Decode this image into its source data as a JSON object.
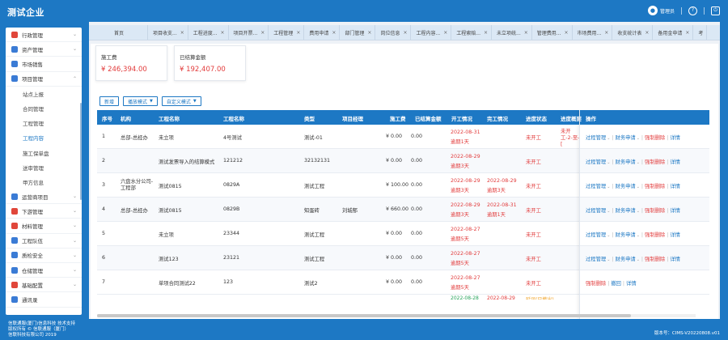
{
  "app": {
    "brand": "测试企业",
    "user": "管理员",
    "colors": {
      "primary": "#1d78c4",
      "danger": "#e23b3b",
      "warning": "#f0a020",
      "success": "#27a35a"
    }
  },
  "sidebar": {
    "items": [
      {
        "label": "行政管理",
        "icon": "admin-icon",
        "color": "#e0463a",
        "expandable": true
      },
      {
        "label": "资产管理",
        "icon": "asset-icon",
        "color": "#3a7bd5",
        "expandable": true
      },
      {
        "label": "市场销售",
        "icon": "market-icon",
        "color": "#3a7bd5",
        "expandable": false
      },
      {
        "label": "项目管理",
        "icon": "project-icon",
        "color": "#3a7bd5",
        "expandable": true,
        "open": true
      },
      {
        "label": "站点上报",
        "sub": true
      },
      {
        "label": "合同管理",
        "sub": true
      },
      {
        "label": "工程管理",
        "sub": true
      },
      {
        "label": "工程内容",
        "sub": true,
        "active": true
      },
      {
        "label": "施工保单盘",
        "sub": true
      },
      {
        "label": "送审管理",
        "sub": true
      },
      {
        "label": "甲方信息",
        "sub": true
      },
      {
        "label": "运营商项目",
        "icon": "operator-icon",
        "color": "#3a7bd5",
        "expandable": true
      },
      {
        "label": "下游管理",
        "icon": "downstream-icon",
        "color": "#e0463a",
        "expandable": true
      },
      {
        "label": "材料管理",
        "icon": "material-icon",
        "color": "#e0463a",
        "expandable": true
      },
      {
        "label": "工程队伍",
        "icon": "team-icon",
        "color": "#3a7bd5",
        "expandable": true
      },
      {
        "label": "质检安全",
        "icon": "quality-icon",
        "color": "#3a7bd5",
        "expandable": true
      },
      {
        "label": "仓储管理",
        "icon": "storage-icon",
        "color": "#3a7bd5",
        "expandable": true
      },
      {
        "label": "基础配置",
        "icon": "config-icon",
        "color": "#e0463a",
        "expandable": true
      },
      {
        "label": "通讯录",
        "icon": "contacts-icon",
        "color": "#3a7bd5",
        "expandable": false
      }
    ]
  },
  "tabs": [
    {
      "label": "首页",
      "closable": false
    },
    {
      "label": "项目收支...",
      "closable": true
    },
    {
      "label": "工程进度...",
      "closable": true
    },
    {
      "label": "项目开票...",
      "closable": true
    },
    {
      "label": "工程管理",
      "closable": true
    },
    {
      "label": "费用申请",
      "closable": true
    },
    {
      "label": "部门管理",
      "closable": true
    },
    {
      "label": "岗位信息",
      "closable": true
    },
    {
      "label": "工程内容...",
      "closable": true
    },
    {
      "label": "工程索赔...",
      "closable": true
    },
    {
      "label": "未立项统...",
      "closable": true
    },
    {
      "label": "管理费用...",
      "closable": true
    },
    {
      "label": "市场费用...",
      "closable": true
    },
    {
      "label": "收支统计表",
      "closable": true
    },
    {
      "label": "备用金申请",
      "closable": true
    },
    {
      "label": "考",
      "closable": false
    }
  ],
  "cards": [
    {
      "label": "施工费",
      "value": "¥ 246,394.00"
    },
    {
      "label": "已结算金额",
      "value": "¥ 192,407.00"
    }
  ],
  "toolbar": {
    "add": "新增",
    "mode": "播放模式",
    "custom": "自定义模式"
  },
  "table": {
    "columns": [
      "序号",
      "机构",
      "工程名称",
      "工程名称",
      "类型",
      "项目经理",
      "施工费",
      "已结算金额",
      "开工情况",
      "完工情况",
      "进度状态",
      "进度概要",
      "操作"
    ],
    "rows": [
      {
        "no": "1",
        "org": "总部-总经办",
        "name": "未立项",
        "code": "4号测试",
        "type": "测试-01",
        "pm": "",
        "fee": "¥ 0.00",
        "settled": "0.00",
        "start": "2022-08-31",
        "start_note": "逾期1天",
        "end": "",
        "end_note": "",
        "status": "未开工",
        "summary": "未开工-2-至-[",
        "actions": [
          "过程管理",
          "财务申请",
          "强制删除",
          "详情"
        ]
      },
      {
        "no": "2",
        "org": "",
        "name": "测试发票导入的结算模式",
        "code": "121212",
        "type": "32132131",
        "pm": "",
        "fee": "¥ 0.00",
        "settled": "0.00",
        "start": "2022-08-29",
        "start_note": "逾期3天",
        "end": "",
        "end_note": "",
        "status": "未开工",
        "summary": "",
        "actions": [
          "过程管理",
          "财务申请",
          "强制删除",
          "详情"
        ]
      },
      {
        "no": "3",
        "org": "六盘水分公司-工程部",
        "name": "测试0815",
        "code": "0829A",
        "type": "测试工程",
        "pm": "",
        "fee": "¥ 100.00",
        "settled": "0.00",
        "start": "2022-08-29",
        "start_note": "逾期3天",
        "end": "2022-08-29",
        "end_note": "逾期3天",
        "status": "未开工",
        "summary": "",
        "actions": [
          "过程管理",
          "财务申请",
          "强制删除",
          "详情"
        ]
      },
      {
        "no": "4",
        "org": "总部-总经办",
        "name": "测试0815",
        "code": "0829B",
        "type": "知蛋砖",
        "pm": "刘城郁",
        "fee": "¥ 660.00",
        "settled": "0.00",
        "start": "2022-08-29",
        "start_note": "逾期3天",
        "end": "2022-08-31",
        "end_note": "逾期1天",
        "status": "未开工",
        "summary": "",
        "actions": [
          "过程管理",
          "财务申请",
          "强制删除",
          "详情"
        ]
      },
      {
        "no": "5",
        "org": "",
        "name": "未立项",
        "code": "23344",
        "type": "测试工程",
        "pm": "",
        "fee": "¥ 0.00",
        "settled": "0.00",
        "start": "2022-08-27",
        "start_note": "逾期5天",
        "end": "",
        "end_note": "",
        "status": "未开工",
        "summary": "",
        "actions": [
          "过程管理",
          "财务申请",
          "强制删除",
          "详情"
        ]
      },
      {
        "no": "6",
        "org": "",
        "name": "测试123",
        "code": "23121",
        "type": "测试工程",
        "pm": "",
        "fee": "¥ 0.00",
        "settled": "0.00",
        "start": "2022-08-27",
        "start_note": "逾期5天",
        "end": "",
        "end_note": "",
        "status": "未开工",
        "summary": "",
        "actions": [
          "过程管理",
          "财务申请",
          "强制删除",
          "详情"
        ]
      },
      {
        "no": "7",
        "org": "",
        "name": "单项合同测试22",
        "code": "123",
        "type": "测试2",
        "pm": "",
        "fee": "¥ 0.00",
        "settled": "0.00",
        "start": "2022-08-27",
        "start_note": "逾期5天",
        "end": "",
        "end_note": "",
        "status": "未开工",
        "summary": "",
        "actions": [
          "强制删除",
          "撤回",
          "详情"
        ]
      }
    ],
    "partial_row": {
      "start": "2022-08-28",
      "end": "2022-08-29",
      "status": "延误(已撤出)"
    }
  },
  "footer": {
    "line1": "信联通服(厦门)信息科技 技术支持",
    "line2": "版权所有 © 信联通服（厦门）",
    "line3": "信联科技有限公司 2019",
    "version": "版本号：CIMS-V20220808.v01"
  }
}
